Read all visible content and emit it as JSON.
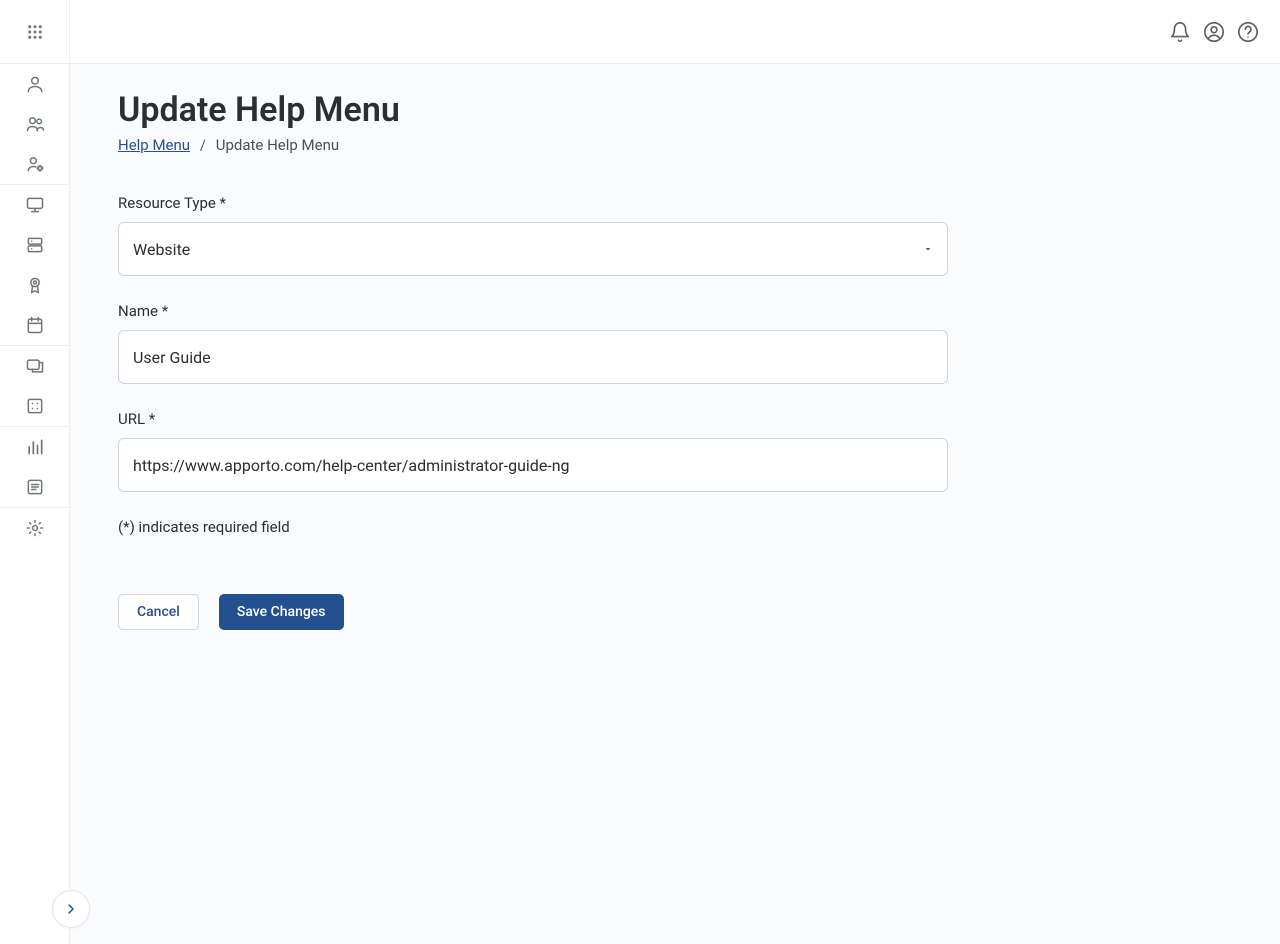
{
  "header": {},
  "page": {
    "title": "Update Help Menu"
  },
  "breadcrumb": {
    "parent_label": "Help Menu",
    "current_label": "Update Help Menu"
  },
  "form": {
    "resource_type": {
      "label": "Resource Type *",
      "value": "Website"
    },
    "name": {
      "label": "Name *",
      "value": "User Guide"
    },
    "url": {
      "label": "URL *",
      "value": "https://www.apporto.com/help-center/administrator-guide-ng"
    },
    "required_note": "(*) indicates required field"
  },
  "actions": {
    "cancel_label": "Cancel",
    "save_label": "Save Changes"
  }
}
